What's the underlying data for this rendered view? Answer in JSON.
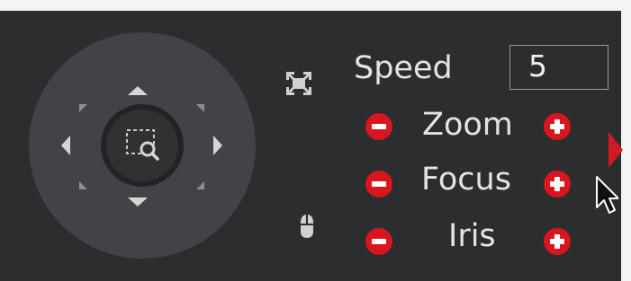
{
  "speed": {
    "label": "Speed",
    "value": "5"
  },
  "zoom": {
    "label": "Zoom"
  },
  "focus": {
    "label": "Focus"
  },
  "iris": {
    "label": "Iris"
  },
  "icons": {
    "fullscreen": "fullscreen-icon",
    "mouse": "mouse-icon",
    "zoom_area": "magnifier-area-icon",
    "minus": "minus-circle-icon",
    "plus": "plus-circle-icon",
    "expand": "triangle-right-icon"
  },
  "colors": {
    "background": "#2c2d2f",
    "joystick": "#424346",
    "accent_red": "#d9161d",
    "text": "#e4e4e4"
  }
}
